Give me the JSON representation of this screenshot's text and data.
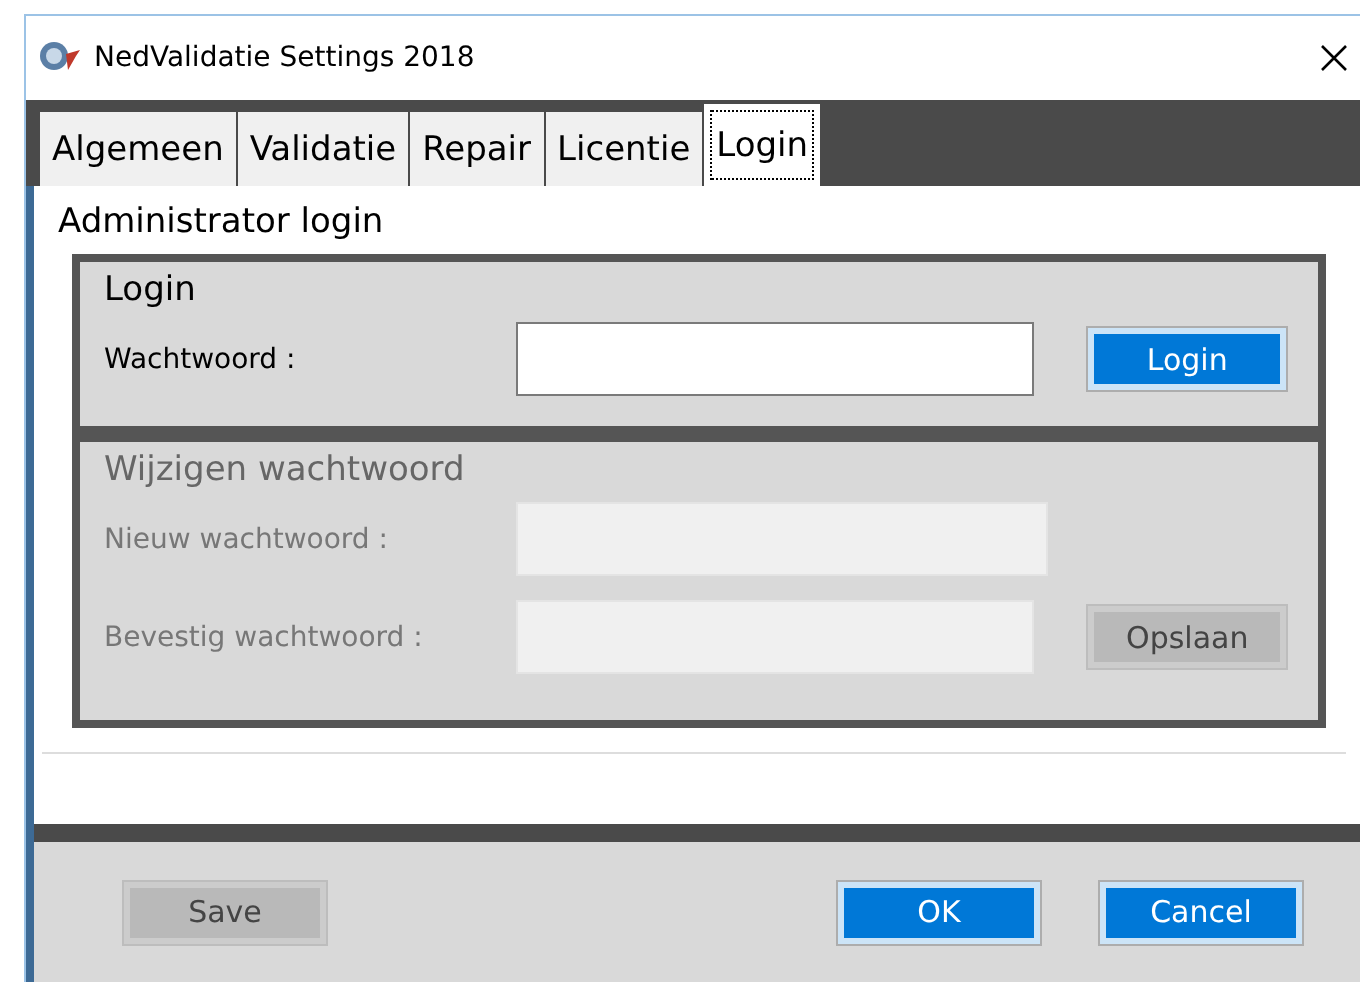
{
  "window": {
    "title": "NedValidatie Settings 2018"
  },
  "tabs": [
    {
      "label": "Algemeen",
      "selected": false
    },
    {
      "label": "Validatie",
      "selected": false
    },
    {
      "label": "Repair",
      "selected": false
    },
    {
      "label": "Licentie",
      "selected": false
    },
    {
      "label": "Login",
      "selected": true
    }
  ],
  "group": {
    "title": "Administrator login"
  },
  "sections": [
    {
      "title": "Login",
      "disabled": false,
      "fields": [
        {
          "label": "Wachtwoord :"
        }
      ],
      "button": {
        "label": "Login"
      }
    },
    {
      "title": "Wijzigen wachtwoord",
      "disabled": true,
      "fields": [
        {
          "label": "Nieuw wachtwoord :"
        },
        {
          "label": "Bevestig wachtwoord :"
        }
      ],
      "button": {
        "label": "Opslaan"
      }
    }
  ],
  "footer": {
    "left_buttons": [
      {
        "label": "Save",
        "disabled": true
      }
    ],
    "right_buttons": [
      {
        "label": "OK",
        "disabled": false
      },
      {
        "label": "Cancel",
        "disabled": false
      }
    ]
  }
}
